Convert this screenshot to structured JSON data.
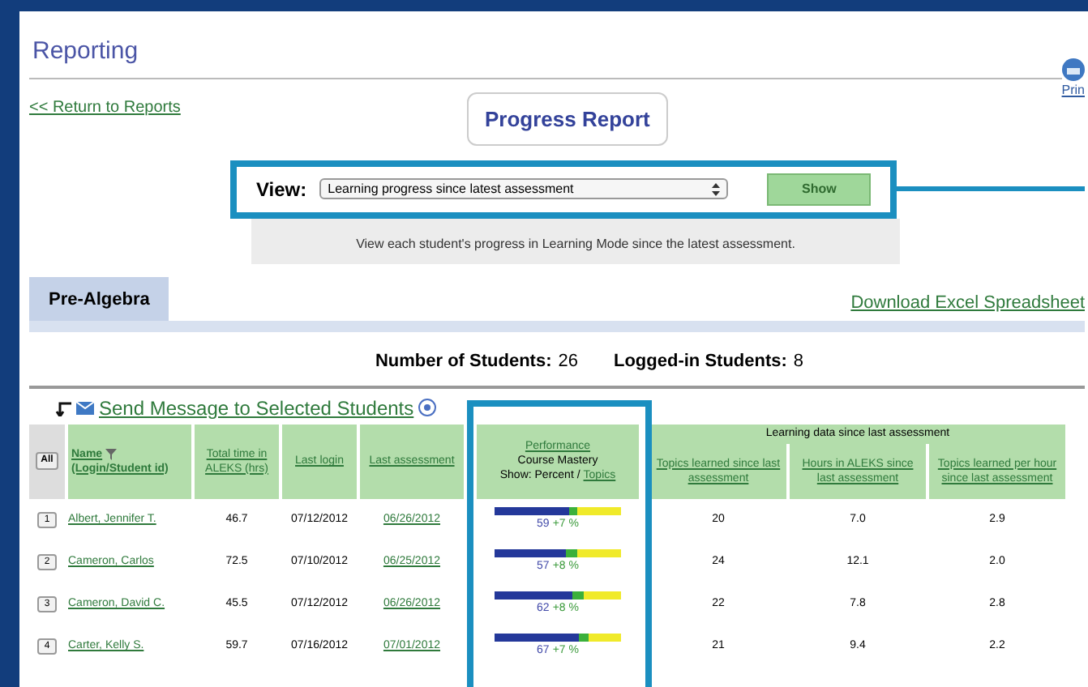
{
  "page_title": "Reporting",
  "print_link": "Prin",
  "return_link": "<< Return to Reports",
  "report_button": "Progress Report",
  "view": {
    "label": "View:",
    "select_value": "Learning progress since latest assessment",
    "show_button": "Show",
    "description": "View each student's progress in Learning Mode since the latest assessment."
  },
  "tabs": [
    {
      "label": "Pre-Algebra",
      "selected": true
    }
  ],
  "download_link": "Download Excel Spreadsheet",
  "counts": [
    {
      "label": "Number of Students:",
      "value": "26"
    },
    {
      "label": "Logged-in Students:",
      "value": "8"
    }
  ],
  "send_message_link": "Send Message to Selected Students",
  "table": {
    "select_all": "All",
    "name_heading": "Name",
    "name_subheading": "(Login/Student id)",
    "columns": [
      "Total time in ALEKS (hrs)",
      "Last login",
      "Last assessment"
    ],
    "performance": {
      "link": "Performance",
      "title": "Course Mastery",
      "show_label": "Show: Percent /",
      "topics_link": "Topics"
    },
    "group_heading": "Learning data since last assessment",
    "learning_columns": [
      "Topics learned since last assessment",
      "Hours in ALEKS since last assessment",
      "Topics learned per hour since last assessment"
    ],
    "rows": [
      {
        "number": "1",
        "name": "Albert, Jennifer T.",
        "total_time": "46.7",
        "last_login": "07/12/2012",
        "last_assessment": "06/26/2012",
        "mastery": {
          "level": 0.59
        },
        "with_gain": {
          "level": 0.66
        },
        "percent": "59",
        "gain_text": "+7 %",
        "topics_learned": "20",
        "hours": "7.0",
        "per_hour": "2.9"
      },
      {
        "number": "2",
        "name": "Cameron, Carlos",
        "total_time": "72.5",
        "last_login": "07/10/2012",
        "last_assessment": "06/25/2012",
        "mastery": {
          "level": 0.57
        },
        "with_gain": {
          "level": 0.65
        },
        "percent": "57",
        "gain_text": "+8 %",
        "topics_learned": "24",
        "hours": "12.1",
        "per_hour": "2.0"
      },
      {
        "number": "3",
        "name": "Cameron, David C.",
        "total_time": "45.5",
        "last_login": "07/12/2012",
        "last_assessment": "06/26/2012",
        "mastery": {
          "level": 0.62
        },
        "with_gain": {
          "level": 0.7
        },
        "percent": "62",
        "gain_text": "+8 %",
        "topics_learned": "22",
        "hours": "7.8",
        "per_hour": "2.8"
      },
      {
        "number": "4",
        "name": "Carter, Kelly S.",
        "total_time": "59.7",
        "last_login": "07/16/2012",
        "last_assessment": "07/01/2012",
        "mastery": {
          "level": 0.67
        },
        "with_gain": {
          "level": 0.74
        },
        "percent": "67",
        "gain_text": "+7 %",
        "topics_learned": "21",
        "hours": "9.4",
        "per_hour": "2.2"
      }
    ]
  }
}
